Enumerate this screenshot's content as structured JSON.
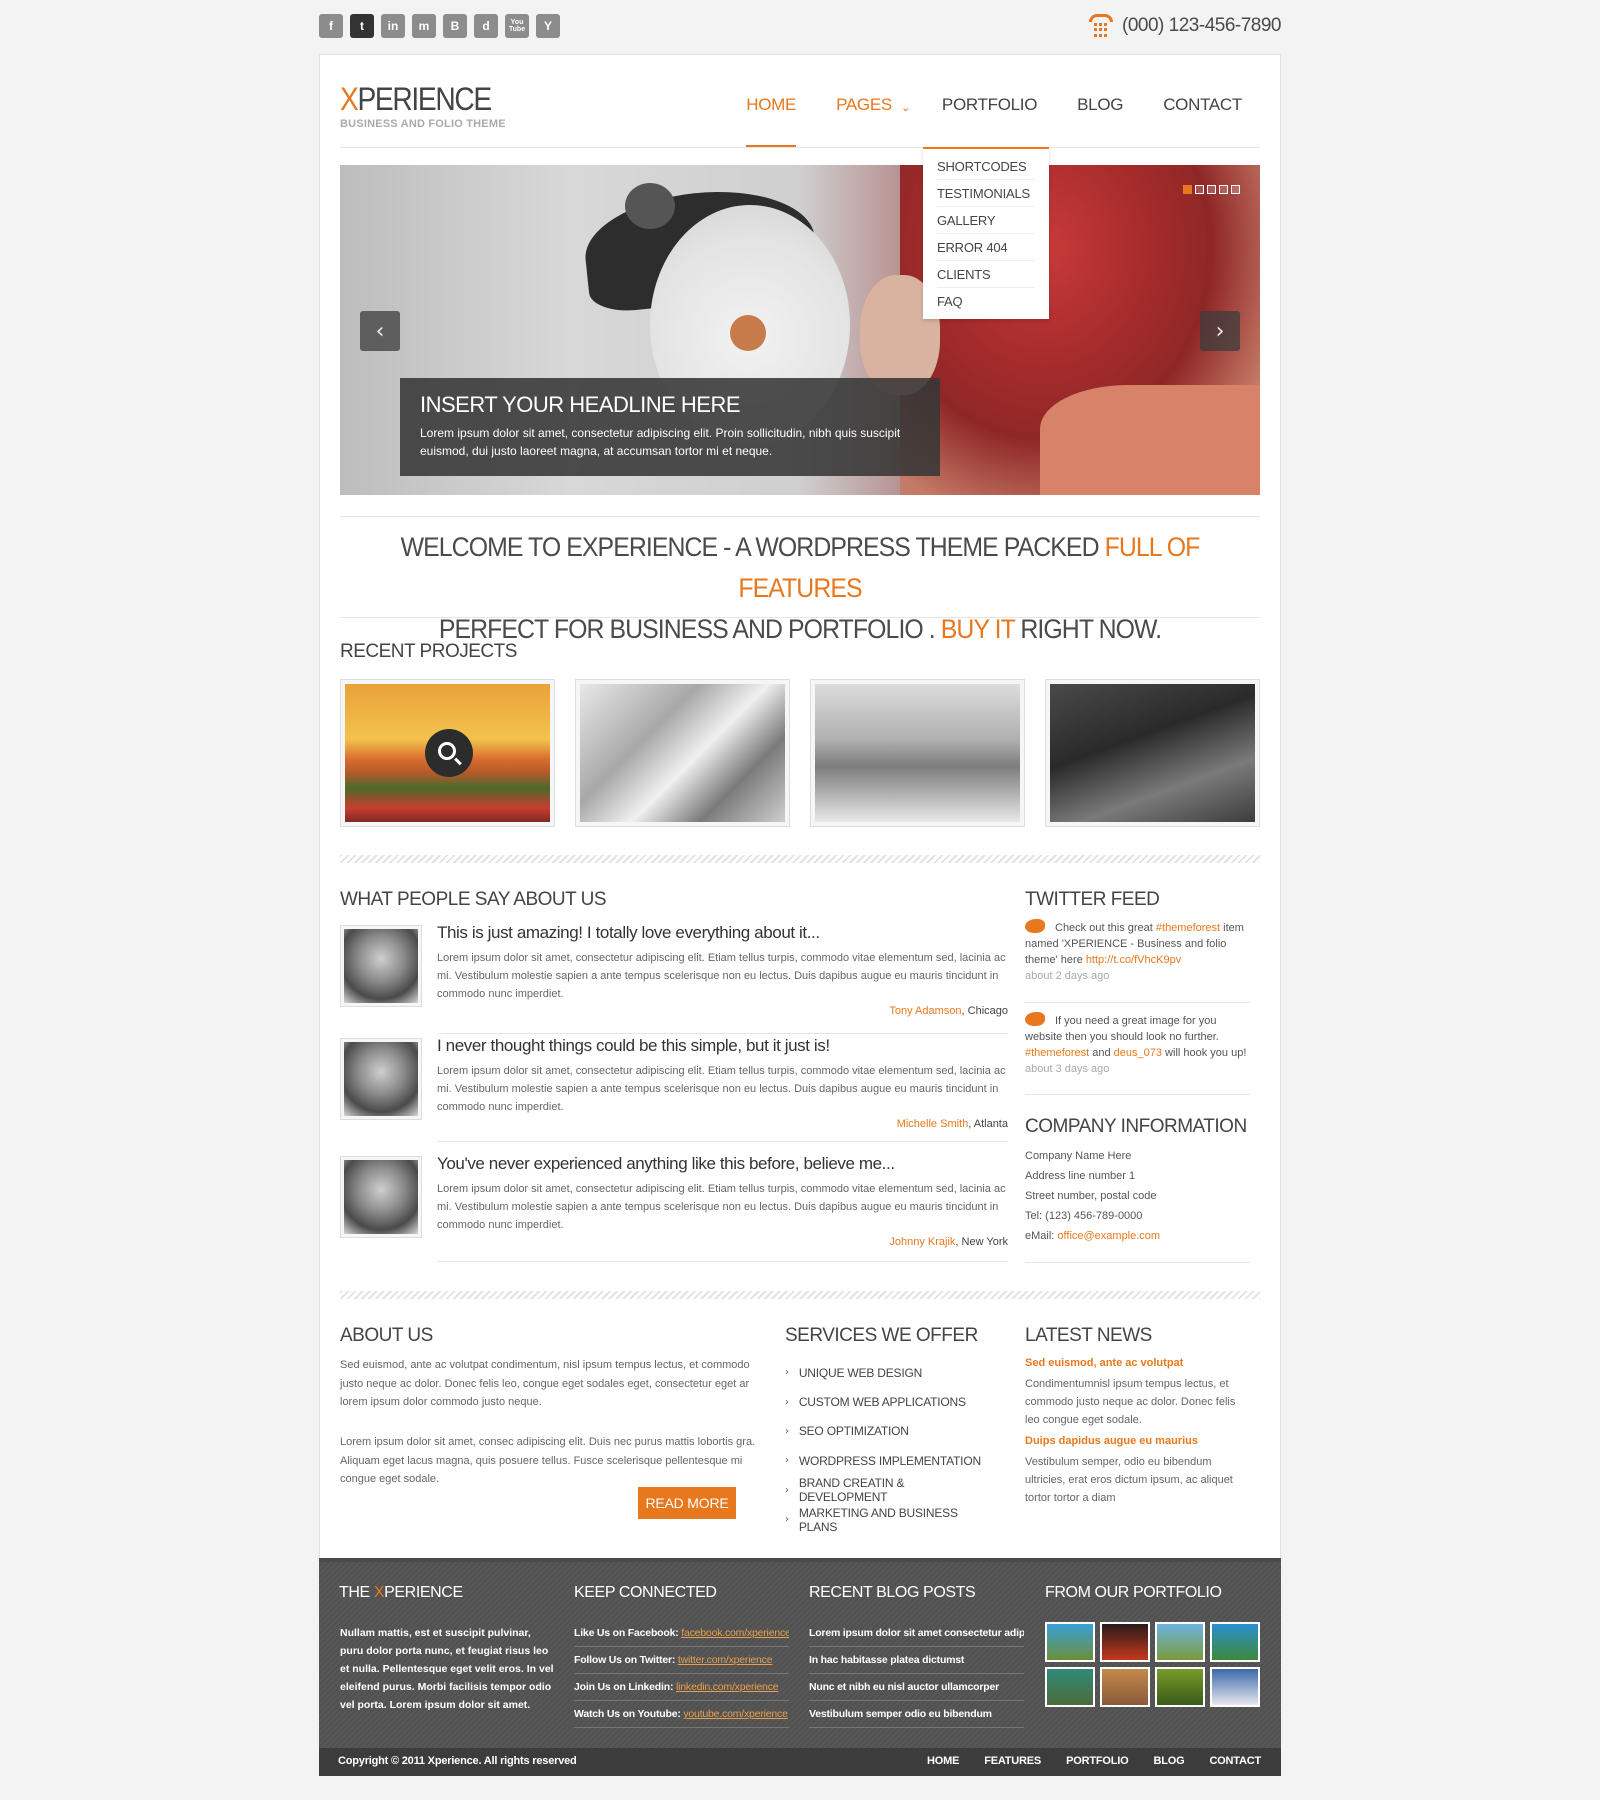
{
  "social": {
    "icons": [
      "facebook-icon",
      "twitter-icon",
      "linkedin-icon",
      "myspace-icon",
      "blogger-icon",
      "delicious-icon",
      "youtube-icon",
      "yahoo-icon"
    ],
    "glyphs": [
      "f",
      "t",
      "in",
      "m",
      "B",
      "d",
      "You Tube",
      "Y"
    ]
  },
  "phone": "(000) 123-456-7890",
  "logo": {
    "first": "X",
    "rest": "PERIENCE",
    "tagline": "BUSINESS AND FOLIO THEME"
  },
  "nav": {
    "home": "HOME",
    "pages": "PAGES",
    "portfolio": "PORTFOLIO",
    "blog": "BLOG",
    "contact": "CONTACT"
  },
  "dropdown": [
    "SHORTCODES",
    "TESTIMONIALS",
    "GALLERY",
    "ERROR 404",
    "CLIENTS",
    "FAQ"
  ],
  "slider": {
    "headline": "INSERT YOUR HEADLINE HERE",
    "text": "Lorem ipsum dolor sit amet, consectetur adipiscing elit. Proin sollicitudin, nibh quis suscipit euismod, dui justo laoreet magna, at accumsan tortor mi et neque.",
    "slides": 5,
    "active_slide": 1
  },
  "welcome": {
    "l1a": "WELCOME TO EXPERIENCE - A WORDPRESS THEME PACKED ",
    "l1b": "FULL OF FEATURES",
    "l2a": "PERFECT FOR BUSINESS AND PORTFOLIO . ",
    "l2b": "BUY IT",
    "l2c": " RIGHT NOW."
  },
  "recent_projects_title": "RECENT PROJECTS",
  "testimonials_title": "WHAT PEOPLE SAY ABOUT US",
  "testimonials": [
    {
      "title": "This is just amazing! I totally love everything about it...",
      "body": "Lorem ipsum dolor sit amet, consectetur adipiscing elit. Etiam tellus turpis, commodo vitae elementum sed, lacinia ac mi. Vestibulum molestie sapien a ante tempus scelerisque non eu lectus. Duis dapibus augue eu mauris tincidunt in commodo nunc imperdiet.",
      "name": "Tony Adamson",
      "city": ", Chicago"
    },
    {
      "title": "I never thought things could be this simple, but it just is!",
      "body": "Lorem ipsum dolor sit amet, consectetur adipiscing elit. Etiam tellus turpis, commodo vitae elementum sed, lacinia ac mi. Vestibulum molestie sapien a ante tempus scelerisque non eu lectus. Duis dapibus augue eu mauris tincidunt in commodo nunc imperdiet.",
      "name": "Michelle Smith",
      "city": ", Atlanta"
    },
    {
      "title": "You've never experienced anything like this before, believe me...",
      "body": "Lorem ipsum dolor sit amet, consectetur adipiscing elit. Etiam tellus turpis, commodo vitae elementum sed, lacinia ac mi. Vestibulum molestie sapien a ante tempus scelerisque non eu lectus. Duis dapibus augue eu mauris tincidunt in commodo nunc imperdiet.",
      "name": "Johnny Krajik",
      "city": ", New York"
    }
  ],
  "twitter": {
    "title": "TWITTER FEED",
    "t1a": "Check out this great ",
    "t1tag": "#themeforest",
    "t1b": " item named 'XPERIENCE - Business and folio theme' here ",
    "t1link": "http://t.co/fVhcK9pv",
    "t1ago": "about 2 days ago",
    "t2a": "If you need a great image for you website then you should look no further. ",
    "t2tag": "#themeforest",
    "t2b": " and ",
    "t2user": "deus_073",
    "t2c": " will hook you up!",
    "t2ago": "about 3 days ago"
  },
  "company": {
    "title": "COMPANY INFORMATION",
    "name": "Company Name Here",
    "address1": "Address line number 1",
    "address2": "Street number, postal code",
    "tel": "Tel: (123) 456-789-0000",
    "email_label": "eMail: ",
    "email": "office@example.com"
  },
  "about": {
    "title": "ABOUT US",
    "p1": "Sed euismod, ante ac volutpat condimentum, nisl ipsum tempus lectus, et commodo justo neque ac dolor. Donec felis leo, congue eget sodales eget, consectetur eget ar lorem ipsum dolor commodo justo neque.",
    "p2": "Lorem ipsum dolor sit amet, consec adipiscing elit. Duis nec purus mattis lobortis gra. Aliquam eget lacus magna, quis posuere tellus. Fusce scelerisque pellentesque mi congue eget sodale.",
    "button": "READ MORE"
  },
  "services": {
    "title": "SERVICES WE OFFER",
    "items": [
      "UNIQUE WEB DESIGN",
      "CUSTOM WEB APPLICATIONS",
      "SEO OPTIMIZATION",
      "WORDPRESS IMPLEMENTATION",
      "BRAND CREATIN & DEVELOPMENT",
      "MARKETING AND BUSINESS PLANS"
    ]
  },
  "news": {
    "title": "LATEST NEWS",
    "n1t": "Sed euismod, ante ac volutpat",
    "n1b": "Condimentumnisl ipsum tempus lectus, et commodo justo neque ac dolor. Donec felis leo congue eget sodale.",
    "n2t": "Duips dapidus augue eu maurius",
    "n2b": "Vestibulum semper, odio eu bibendum ultricies, erat eros dictum ipsum, ac aliquet tortor tortor a diam"
  },
  "footer": {
    "xp_a": "THE ",
    "xp_b": "X",
    "xp_c": "PERIENCE",
    "xp_text": "Nullam mattis, est et suscipit pulvinar, puru dolor porta nunc, et feugiat risus leo et nulla. Pellentesque eget velit eros. In vel eleifend purus. Morbi facilisis tempor odio vel porta. Lorem ipsum dolor sit amet.",
    "keep_title": "KEEP CONNECTED",
    "keep": [
      {
        "label": "Like Us on Facebook: ",
        "url": "facebook.com/xperience"
      },
      {
        "label": "Follow Us on Twitter: ",
        "url": "twitter.com/xperience"
      },
      {
        "label": "Join Us on Linkedin: ",
        "url": "linkedin.com/xperience"
      },
      {
        "label": "Watch Us on Youtube: ",
        "url": "youtube.com/xperience"
      }
    ],
    "blog_title": "RECENT BLOG POSTS",
    "blog": [
      "Lorem ipsum dolor sit amet consectetur adipi",
      "In hac habitasse platea dictumst",
      "Nunc et nibh eu nisl auctor ullamcorper",
      "Vestibulum semper odio eu bibendum"
    ],
    "portfolio_title": "FROM OUR PORTFOLIO",
    "copyright": "Copyright © 2011 Xperience. All rights reserved",
    "nav": [
      "HOME",
      "FEATURES",
      "PORTFOLIO",
      "BLOG",
      "CONTACT"
    ]
  },
  "colors": {
    "accent": "#e8781d",
    "footer_bg": "#555555",
    "bottom_bar": "#3c3c3c"
  }
}
